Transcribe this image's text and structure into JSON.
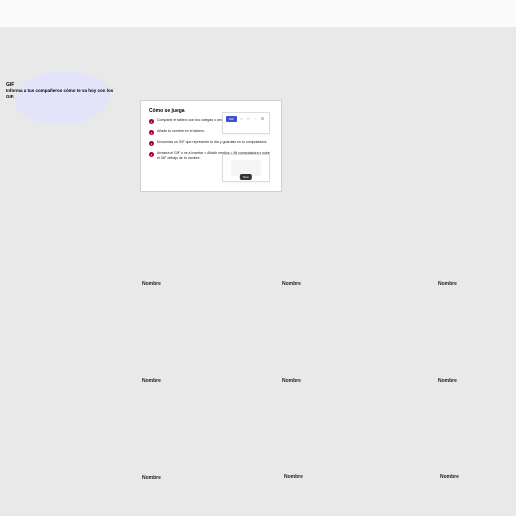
{
  "header": {
    "gif_title": "GIF",
    "gif_subtitle": "Informa a tus compañeros cómo te va hoy con los GIF."
  },
  "panel": {
    "title": "Cómo se juega",
    "steps": [
      {
        "num": "1",
        "text": "Comparte el tablero con tus colegas o amigos."
      },
      {
        "num": "2",
        "text": "Añade tu nombre en el tablero."
      },
      {
        "num": "3",
        "text": "Encuentra un GIF que represente tu día y guárdalo en tu computadora."
      },
      {
        "num": "4",
        "text": "Arrastra el GIF o ve a Insertar > Añadir medios > Mi computadora y sube el GIF debajo de tu nombre."
      }
    ],
    "gif_button": "GIF"
  },
  "preview2": {
    "tag": "Nom"
  },
  "labels": [
    "Nombre",
    "Nombre",
    "Nombre",
    "Nombre",
    "Nombre",
    "Nombre",
    "Nombre",
    "Nombre",
    "Nombre"
  ]
}
